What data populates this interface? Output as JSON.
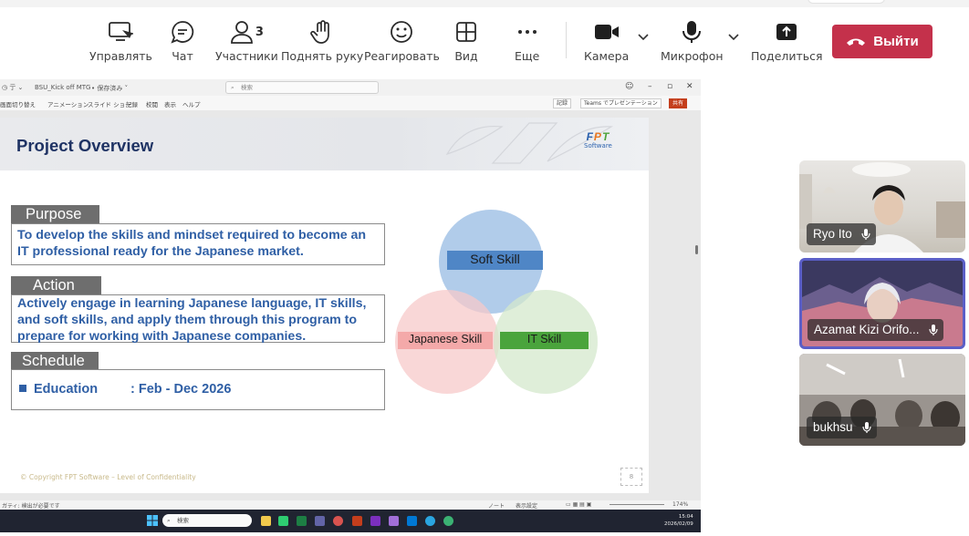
{
  "toolbar": {
    "manage": "Управлять",
    "chat": "Чат",
    "participants": "Участники",
    "participants_count": "3",
    "raise_hand": "Поднять руку",
    "react": "Реагировать",
    "view": "Вид",
    "more": "Еще",
    "camera": "Камера",
    "microphone": "Микрофон",
    "share": "Поделиться",
    "leave": "Выйти",
    "leave_color": "#c4314b"
  },
  "ppt": {
    "file_name": "BSU_Kick off MTG",
    "autosave": "• 保存済み ˅",
    "search_placeholder": "検索",
    "menu": [
      "画面切り替え",
      "アニメーション",
      "スライド ショー",
      "記録",
      "校閲",
      "表示",
      "ヘルプ"
    ],
    "record_btn": "記録",
    "teams_btn": "Teams でプレゼンテーション",
    "share_btn": "共有",
    "status_left": "ガティ: 検出が必要です",
    "status_notes": "ノート",
    "status_display": "表示設定",
    "zoom": "174%"
  },
  "slide": {
    "title": "Project Overview",
    "logo_text_sub": "Software",
    "sections": {
      "purpose": {
        "label": "Purpose",
        "text": "To develop the skills and mindset required to become an IT professional ready for the Japanese market."
      },
      "action": {
        "label": "Action",
        "text": "Actively engage in learning Japanese language, IT skills, and soft skills, and apply them through this program to prepare for working with Japanese companies."
      },
      "schedule": {
        "label": "Schedule",
        "item": "Education",
        "date": ": Feb - Dec  2026"
      }
    },
    "venn": {
      "soft_skill": "Soft Skill",
      "japanese_skill": "Japanese Skill",
      "it_skill": "IT Skill",
      "colors": {
        "soft": "#a9c6e8",
        "japanese": "#f7c9c9",
        "it": "#d4e8cc",
        "soft_label": "#4f86c6",
        "japanese_label": "#f4a9a9",
        "it_label": "#4aa43c"
      }
    },
    "copyright": "© Copyright FPT Software – Level of Confidentiality",
    "slide_number": "8"
  },
  "taskbar": {
    "search_placeholder": "検索",
    "time": "15:04",
    "date": "2026/02/09"
  },
  "participants": [
    {
      "name": "Ryo Ito"
    },
    {
      "name": "Azamat Kizi Orifo..."
    },
    {
      "name": "bukhsu"
    }
  ]
}
